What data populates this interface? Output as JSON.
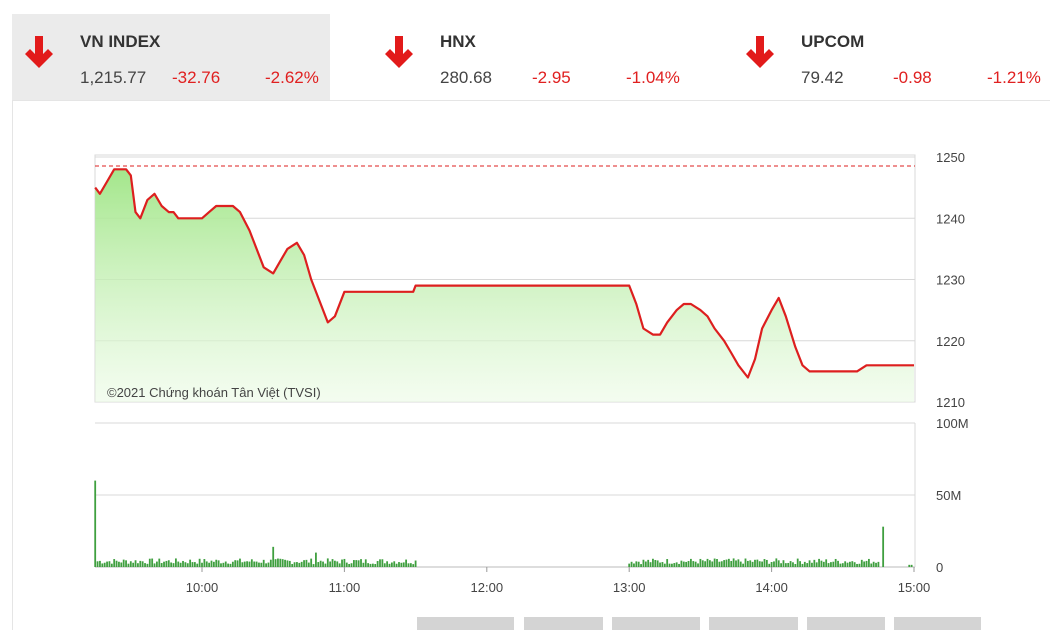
{
  "indices": [
    {
      "name": "VN INDEX",
      "value": "1,215.77",
      "change": "-32.76",
      "percent": "-2.62%",
      "direction": "down",
      "active": true
    },
    {
      "name": "HNX",
      "value": "280.68",
      "change": "-2.95",
      "percent": "-1.04%",
      "direction": "down",
      "active": false
    },
    {
      "name": "UPCOM",
      "value": "79.42",
      "change": "-0.98",
      "percent": "-1.21%",
      "direction": "down",
      "active": false
    }
  ],
  "colors": {
    "down": "#e21a1a",
    "line": "#dd1f1f",
    "area_top": "#a8e88c",
    "volume": "#3f9f3f",
    "grid": "#d8d8d8"
  },
  "watermark": "©2021 Chứng khoán Tân Việt (TVSI)",
  "chart_data": {
    "type": "line",
    "x_ticks": [
      "10:00",
      "11:00",
      "12:00",
      "13:00",
      "14:00",
      "15:00"
    ],
    "price": {
      "y_ticks": [
        1250,
        1240,
        1230,
        1220,
        1210
      ],
      "ylim": [
        1210,
        1250
      ],
      "reference": 1248.53,
      "x": [
        "09:15",
        "09:17",
        "09:20",
        "09:23",
        "09:26",
        "09:28",
        "09:30",
        "09:32",
        "09:34",
        "09:37",
        "09:40",
        "09:43",
        "09:46",
        "09:48",
        "09:50",
        "09:53",
        "09:56",
        "10:00",
        "10:03",
        "10:06",
        "10:10",
        "10:13",
        "10:16",
        "10:20",
        "10:23",
        "10:26",
        "10:30",
        "10:33",
        "10:36",
        "10:40",
        "10:43",
        "10:46",
        "10:50",
        "10:53",
        "10:56",
        "11:00",
        "11:03",
        "11:06",
        "11:10",
        "11:13",
        "11:16",
        "11:20",
        "11:22",
        "11:25",
        "11:28",
        "11:29",
        "11:30",
        "13:00",
        "13:03",
        "13:06",
        "13:10",
        "13:13",
        "13:16",
        "13:20",
        "13:23",
        "13:26",
        "13:30",
        "13:33",
        "13:36",
        "13:40",
        "13:43",
        "13:46",
        "13:50",
        "13:53",
        "13:56",
        "14:00",
        "14:03",
        "14:06",
        "14:10",
        "14:13",
        "14:16",
        "14:20",
        "14:23",
        "14:26",
        "14:30",
        "14:33",
        "14:36",
        "14:40",
        "14:43",
        "14:46",
        "14:50",
        "14:53",
        "14:56",
        "15:00"
      ],
      "y": [
        1245,
        1244,
        1246,
        1248,
        1248,
        1248,
        1247,
        1241,
        1240,
        1243,
        1244,
        1242,
        1241,
        1241,
        1240,
        1240,
        1240,
        1240,
        1241,
        1242,
        1242,
        1242,
        1241,
        1238,
        1235,
        1232,
        1231,
        1233,
        1235,
        1236,
        1234,
        1230,
        1226,
        1223,
        1224,
        1228,
        1228,
        1228,
        1228,
        1228,
        1228,
        1228,
        1228,
        1228,
        1228,
        1228,
        1229,
        1229,
        1226,
        1222,
        1221,
        1221,
        1223,
        1225,
        1226,
        1226,
        1225,
        1224,
        1222,
        1220,
        1218,
        1216,
        1214,
        1217,
        1222,
        1225,
        1227,
        1224,
        1219,
        1216,
        1215,
        1215,
        1215,
        1215,
        1215,
        1215,
        1215,
        1216,
        1216,
        1216,
        1216,
        1216,
        1216,
        1216
      ]
    },
    "volume": {
      "y_ticks_labels": [
        "100M",
        "50M",
        "0"
      ],
      "ylim": [
        0,
        100
      ],
      "unit": "M",
      "bars": [
        {
          "time": "09:15",
          "value": 60
        },
        {
          "time": "10:30",
          "value": 14
        },
        {
          "time": "10:48",
          "value": 10
        },
        {
          "time": "14:47",
          "value": 28
        }
      ],
      "typical_value": 4
    }
  },
  "bottom_buttons": [
    "",
    "",
    "",
    "",
    "",
    ""
  ]
}
